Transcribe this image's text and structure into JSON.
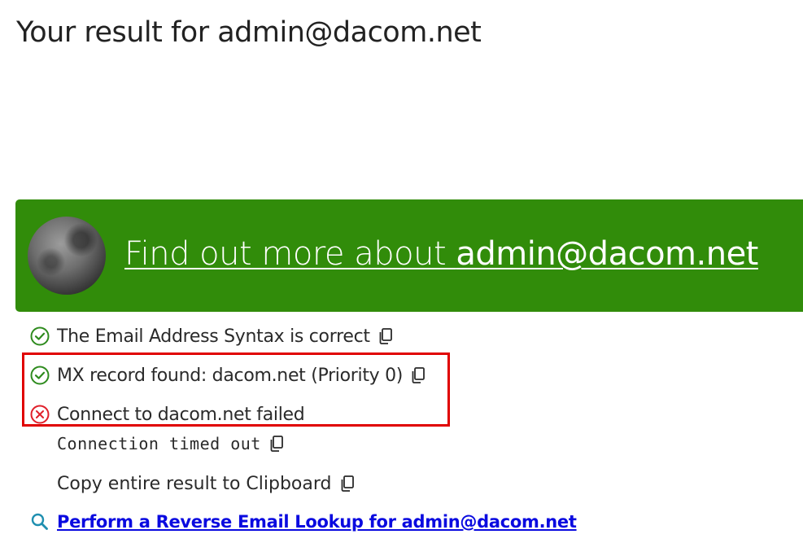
{
  "page": {
    "title": "Your result for admin@dacom.net"
  },
  "banner": {
    "link_prefix": "Find out more about ",
    "link_email": "admin@dacom.net",
    "color": "#318c0a"
  },
  "results": {
    "syntax": {
      "text": "The Email Address Syntax is correct",
      "status": "ok",
      "icon": "check-circle-icon"
    },
    "mx": {
      "text": "MX record found: dacom.net (Priority 0)",
      "status": "ok",
      "icon": "check-circle-icon"
    },
    "connect": {
      "text": "Connect to dacom.net failed",
      "status": "error",
      "icon": "x-circle-icon"
    },
    "connect_detail": "Connection timed out",
    "copy_all": "Copy entire result to Clipboard"
  },
  "reverse_lookup": {
    "link": "Perform a Reverse Email Lookup for admin@dacom.net",
    "icon": "search-icon",
    "color": "#0a0ae0"
  },
  "colors": {
    "ok": "#2e8b1e",
    "error": "#e0202a",
    "highlight_border": "#e00000"
  }
}
